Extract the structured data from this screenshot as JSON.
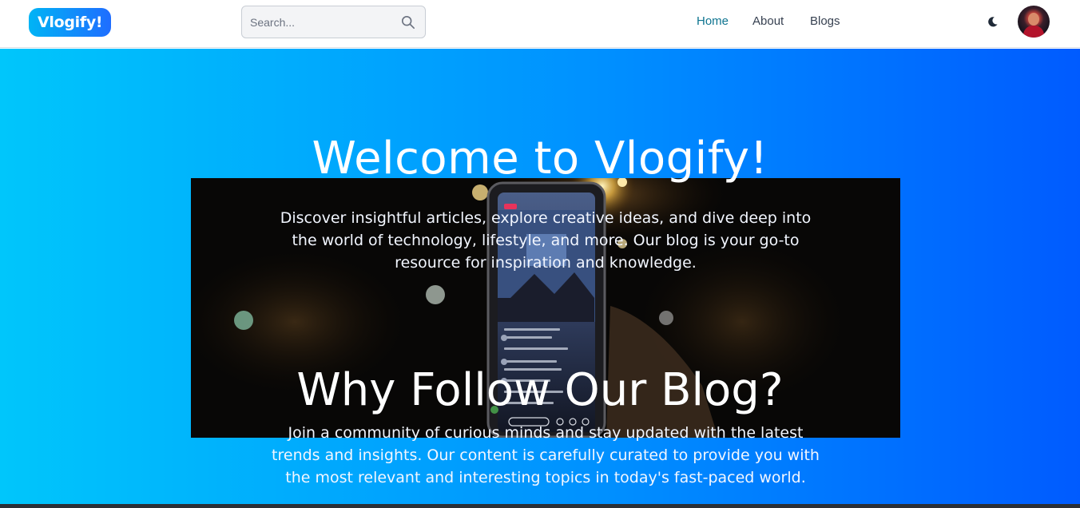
{
  "navbar": {
    "logo": "Vlogify!",
    "search": {
      "placeholder": "Search...",
      "icon": "search-icon"
    },
    "links": [
      {
        "label": "Home",
        "active": true
      },
      {
        "label": "About",
        "active": false
      },
      {
        "label": "Blogs",
        "active": false
      }
    ],
    "theme_toggle_icon": "moon-icon",
    "avatar_icon": "user-avatar"
  },
  "hero": {
    "title": "Welcome to Vlogify!",
    "intro": "Discover insightful articles, explore creative ideas, and dive deep into the world of technology, lifestyle, and more. Our blog is your go-to resource for inspiration and knowledge.",
    "subtitle": "Why Follow Our Blog?",
    "body": "Join a community of curious minds and stay updated with the latest trends and insights. Our content is carefully curated to provide you with the most relevant and interesting topics in today's fast-paced world.",
    "image_description_icon": "concert-phone-photo"
  },
  "colors": {
    "gradient_start": "#00c6fb",
    "gradient_end": "#005bff",
    "active_link": "#0e7490",
    "link": "#374151"
  }
}
